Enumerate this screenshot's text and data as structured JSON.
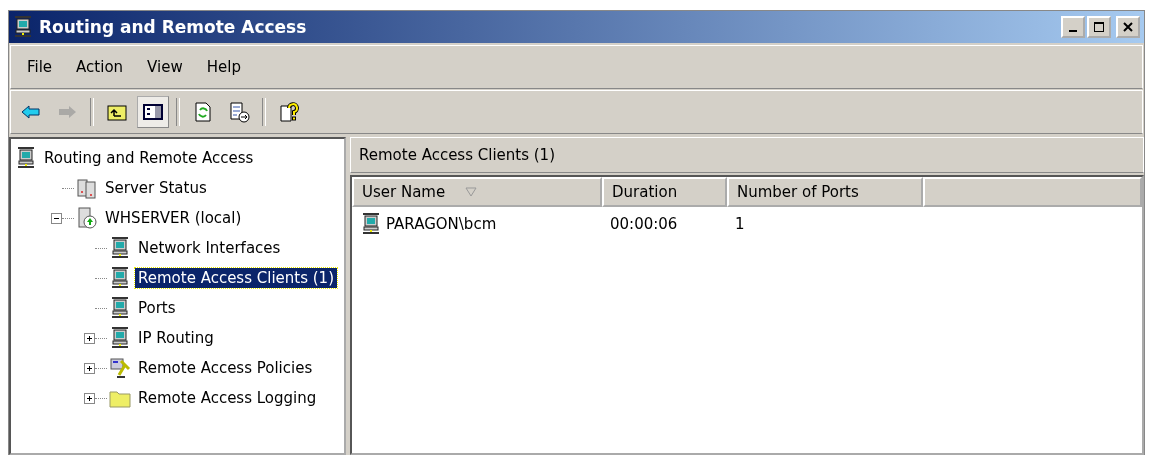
{
  "window": {
    "title": "Routing and Remote Access"
  },
  "menu": [
    "File",
    "Action",
    "View",
    "Help"
  ],
  "toolbar": [
    {
      "kind": "back",
      "disabled": false
    },
    {
      "kind": "forward",
      "disabled": true
    },
    {
      "kind": "sep"
    },
    {
      "kind": "up",
      "disabled": false
    },
    {
      "kind": "tree",
      "disabled": false,
      "selected": true
    },
    {
      "kind": "sep"
    },
    {
      "kind": "refresh",
      "disabled": false
    },
    {
      "kind": "export",
      "disabled": false
    },
    {
      "kind": "sep"
    },
    {
      "kind": "help",
      "disabled": false
    }
  ],
  "tree": [
    {
      "label": "Routing and Remote Access",
      "kind": "network",
      "selected": false,
      "children": [
        {
          "label": "Server Status",
          "kind": "status",
          "selected": false
        },
        {
          "label": "WHSERVER (local)",
          "kind": "server",
          "selected": false,
          "expanded": true,
          "children": [
            {
              "label": "Network Interfaces",
              "kind": "network",
              "selected": false
            },
            {
              "label": "Remote Access Clients (1)",
              "kind": "network",
              "selected": true
            },
            {
              "label": "Ports",
              "kind": "network",
              "selected": false
            },
            {
              "label": "IP Routing",
              "kind": "network",
              "selected": false,
              "expanded": false
            },
            {
              "label": "Remote Access Policies",
              "kind": "policy",
              "selected": false,
              "expanded": false
            },
            {
              "label": "Remote Access Logging",
              "kind": "folder",
              "selected": false,
              "expanded": false
            }
          ]
        }
      ]
    }
  ],
  "pane": {
    "title": "Remote Access Clients (1)",
    "columns": [
      {
        "label": "User Name",
        "sorted": true
      },
      {
        "label": "Duration",
        "sorted": false
      },
      {
        "label": "Number of Ports",
        "sorted": false
      }
    ],
    "rows": [
      {
        "cells": [
          "PARAGON\\bcm",
          "00:00:06",
          "1"
        ],
        "selected": false
      }
    ]
  }
}
